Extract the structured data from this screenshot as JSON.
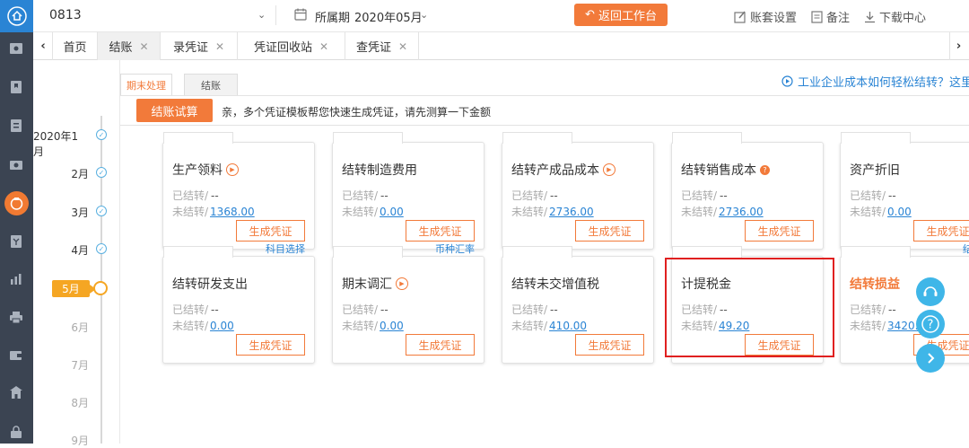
{
  "topbar": {
    "company": "0813",
    "period_label": "所属期",
    "period_value": "2020年05月",
    "return_button": "返回工作台",
    "tools": [
      {
        "label": "账套设置",
        "icon": "edit-icon"
      },
      {
        "label": "备注",
        "icon": "note-icon"
      },
      {
        "label": "下载中心",
        "icon": "download-icon"
      }
    ]
  },
  "tabs": [
    {
      "label": "首页",
      "closable": false
    },
    {
      "label": "结账",
      "closable": true,
      "active": true
    },
    {
      "label": "录凭证",
      "closable": true
    },
    {
      "label": "凭证回收站",
      "closable": true
    },
    {
      "label": "查凭证",
      "closable": true
    }
  ],
  "subtabs": [
    "期末处理",
    "结账"
  ],
  "help_link": "工业企业成本如何轻松结转？这里有",
  "trial_button": "结账试算",
  "hint": "亲，多个凭证模板帮您快速生成凭证，请先测算一下金额",
  "timeline": {
    "months": [
      "2020年1月",
      "2月",
      "3月",
      "4月",
      "5月",
      "6月",
      "7月",
      "8月",
      "9月"
    ],
    "done_months": [
      "2020年1月",
      "2月",
      "3月",
      "4月"
    ],
    "active_month": "5月"
  },
  "card_labels": {
    "done_prefix": "已结转/",
    "undone_prefix": "未结转/",
    "empty_value": "--",
    "generate": "生成凭证"
  },
  "cards": [
    {
      "title": "生产领料",
      "icon": "play",
      "amount": "1368.00",
      "link": ""
    },
    {
      "title": "结转制造费用",
      "icon": "",
      "amount": "0.00",
      "link": ""
    },
    {
      "title": "结转产成品成本",
      "icon": "play",
      "amount": "2736.00",
      "link": ""
    },
    {
      "title": "结转销售成本",
      "icon": "question",
      "amount": "2736.00",
      "link": ""
    },
    {
      "title": "资产折旧",
      "icon": "",
      "amount": "0.00",
      "link": ""
    },
    {
      "title": "结转研发支出",
      "icon": "",
      "amount": "0.00",
      "link": "科目选择"
    },
    {
      "title": "期末调汇",
      "icon": "play",
      "amount": "0.00",
      "link": "币种汇率"
    },
    {
      "title": "结转未交增值税",
      "icon": "",
      "amount": "410.00",
      "link": ""
    },
    {
      "title": "计提税金",
      "icon": "",
      "amount": "49.20",
      "link": ""
    },
    {
      "title": "结转损益",
      "icon": "",
      "amount": "3420.0",
      "link": "结转",
      "orange": true
    }
  ],
  "colors": {
    "accent": "#f27a3a",
    "link": "#2a84d4",
    "sidebar": "#3b4452",
    "highlight": "#e02020"
  }
}
